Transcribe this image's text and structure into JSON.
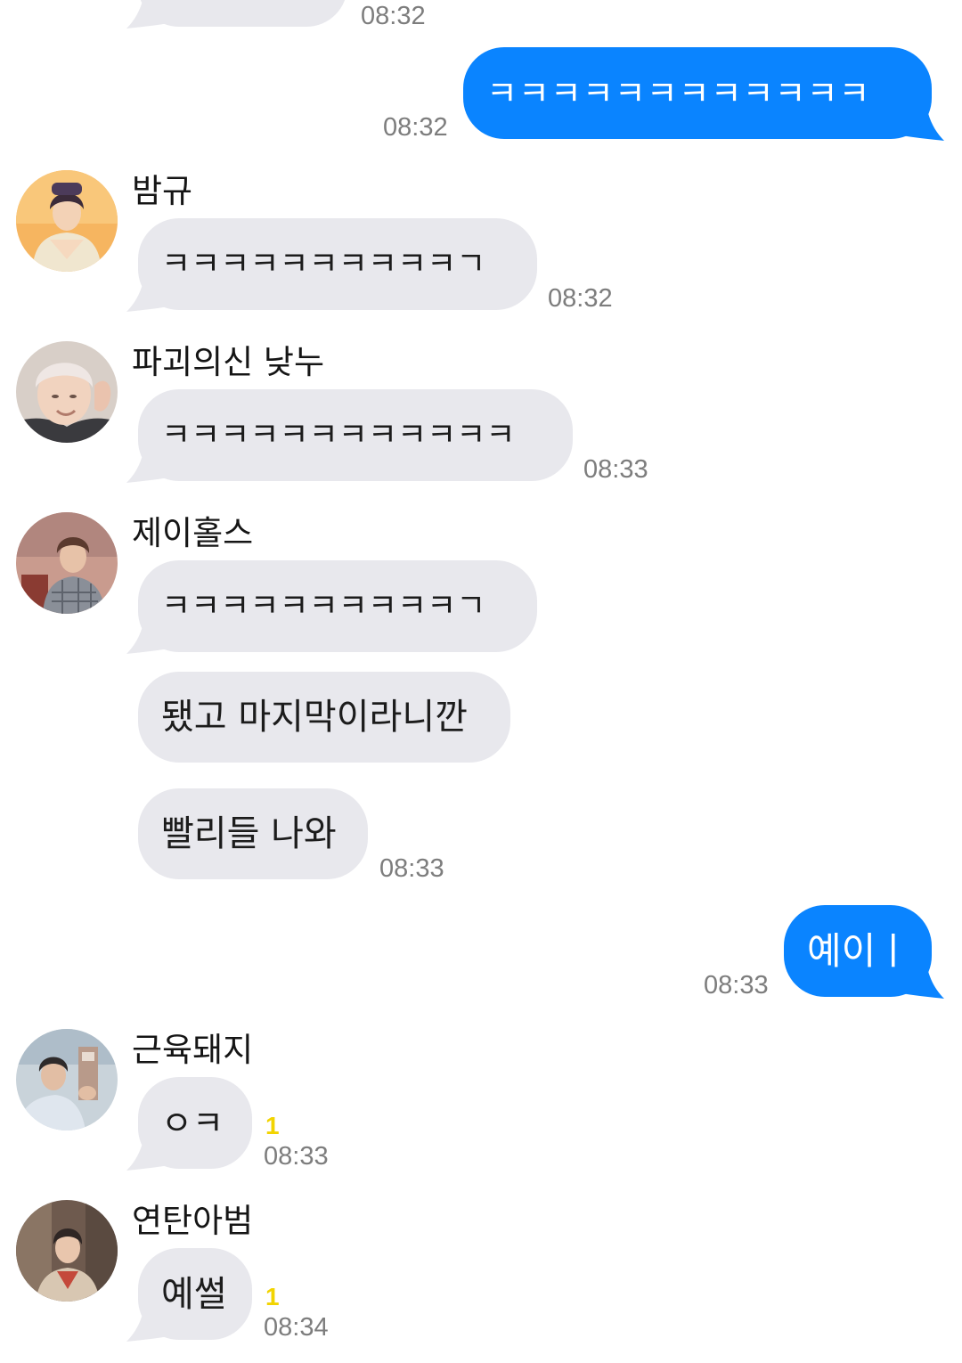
{
  "messages": {
    "m0": {
      "time": "08:32"
    },
    "m1": {
      "text": "ㅋㅋㅋㅋㅋㅋㅋㅋㅋㅋㅋㅋ",
      "time": "08:32"
    },
    "m2": {
      "sender": "밤규",
      "text": "ㅋㅋㅋㅋㅋㅋㅋㅋㅋㅋㄱ",
      "time": "08:32"
    },
    "m3": {
      "sender": "파괴의신 낮누",
      "text": "ㅋㅋㅋㅋㅋㅋㅋㅋㅋㅋㅋㅋ",
      "time": "08:33"
    },
    "m4": {
      "sender": "제이홀스",
      "text": "ㅋㅋㅋㅋㅋㅋㅋㅋㅋㅋㄱ"
    },
    "m5": {
      "text": "됐고 마지막이라니깐"
    },
    "m6": {
      "text": "빨리들 나와",
      "time": "08:33"
    },
    "m7": {
      "text": "예이ㅣ",
      "time": "08:33"
    },
    "m8": {
      "sender": "근육돼지",
      "text": "ㅇㅋ",
      "unread": "1",
      "time": "08:33"
    },
    "m9": {
      "sender": "연탄아범",
      "text": "예썰",
      "unread": "1",
      "time": "08:34"
    }
  },
  "icons": {
    "incoming_tail": "bubble-tail-left",
    "outgoing_tail": "bubble-tail-right",
    "avatars": [
      "avatar-bamgyu",
      "avatar-paguiuisin",
      "avatar-jhorse",
      "avatar-geunyuk",
      "avatar-yeontan"
    ]
  },
  "colors": {
    "outgoing_bubble": "#0a84ff",
    "incoming_bubble": "#e8e8ed",
    "timestamp": "#7d7d7d",
    "unread_count": "#f2d400"
  }
}
